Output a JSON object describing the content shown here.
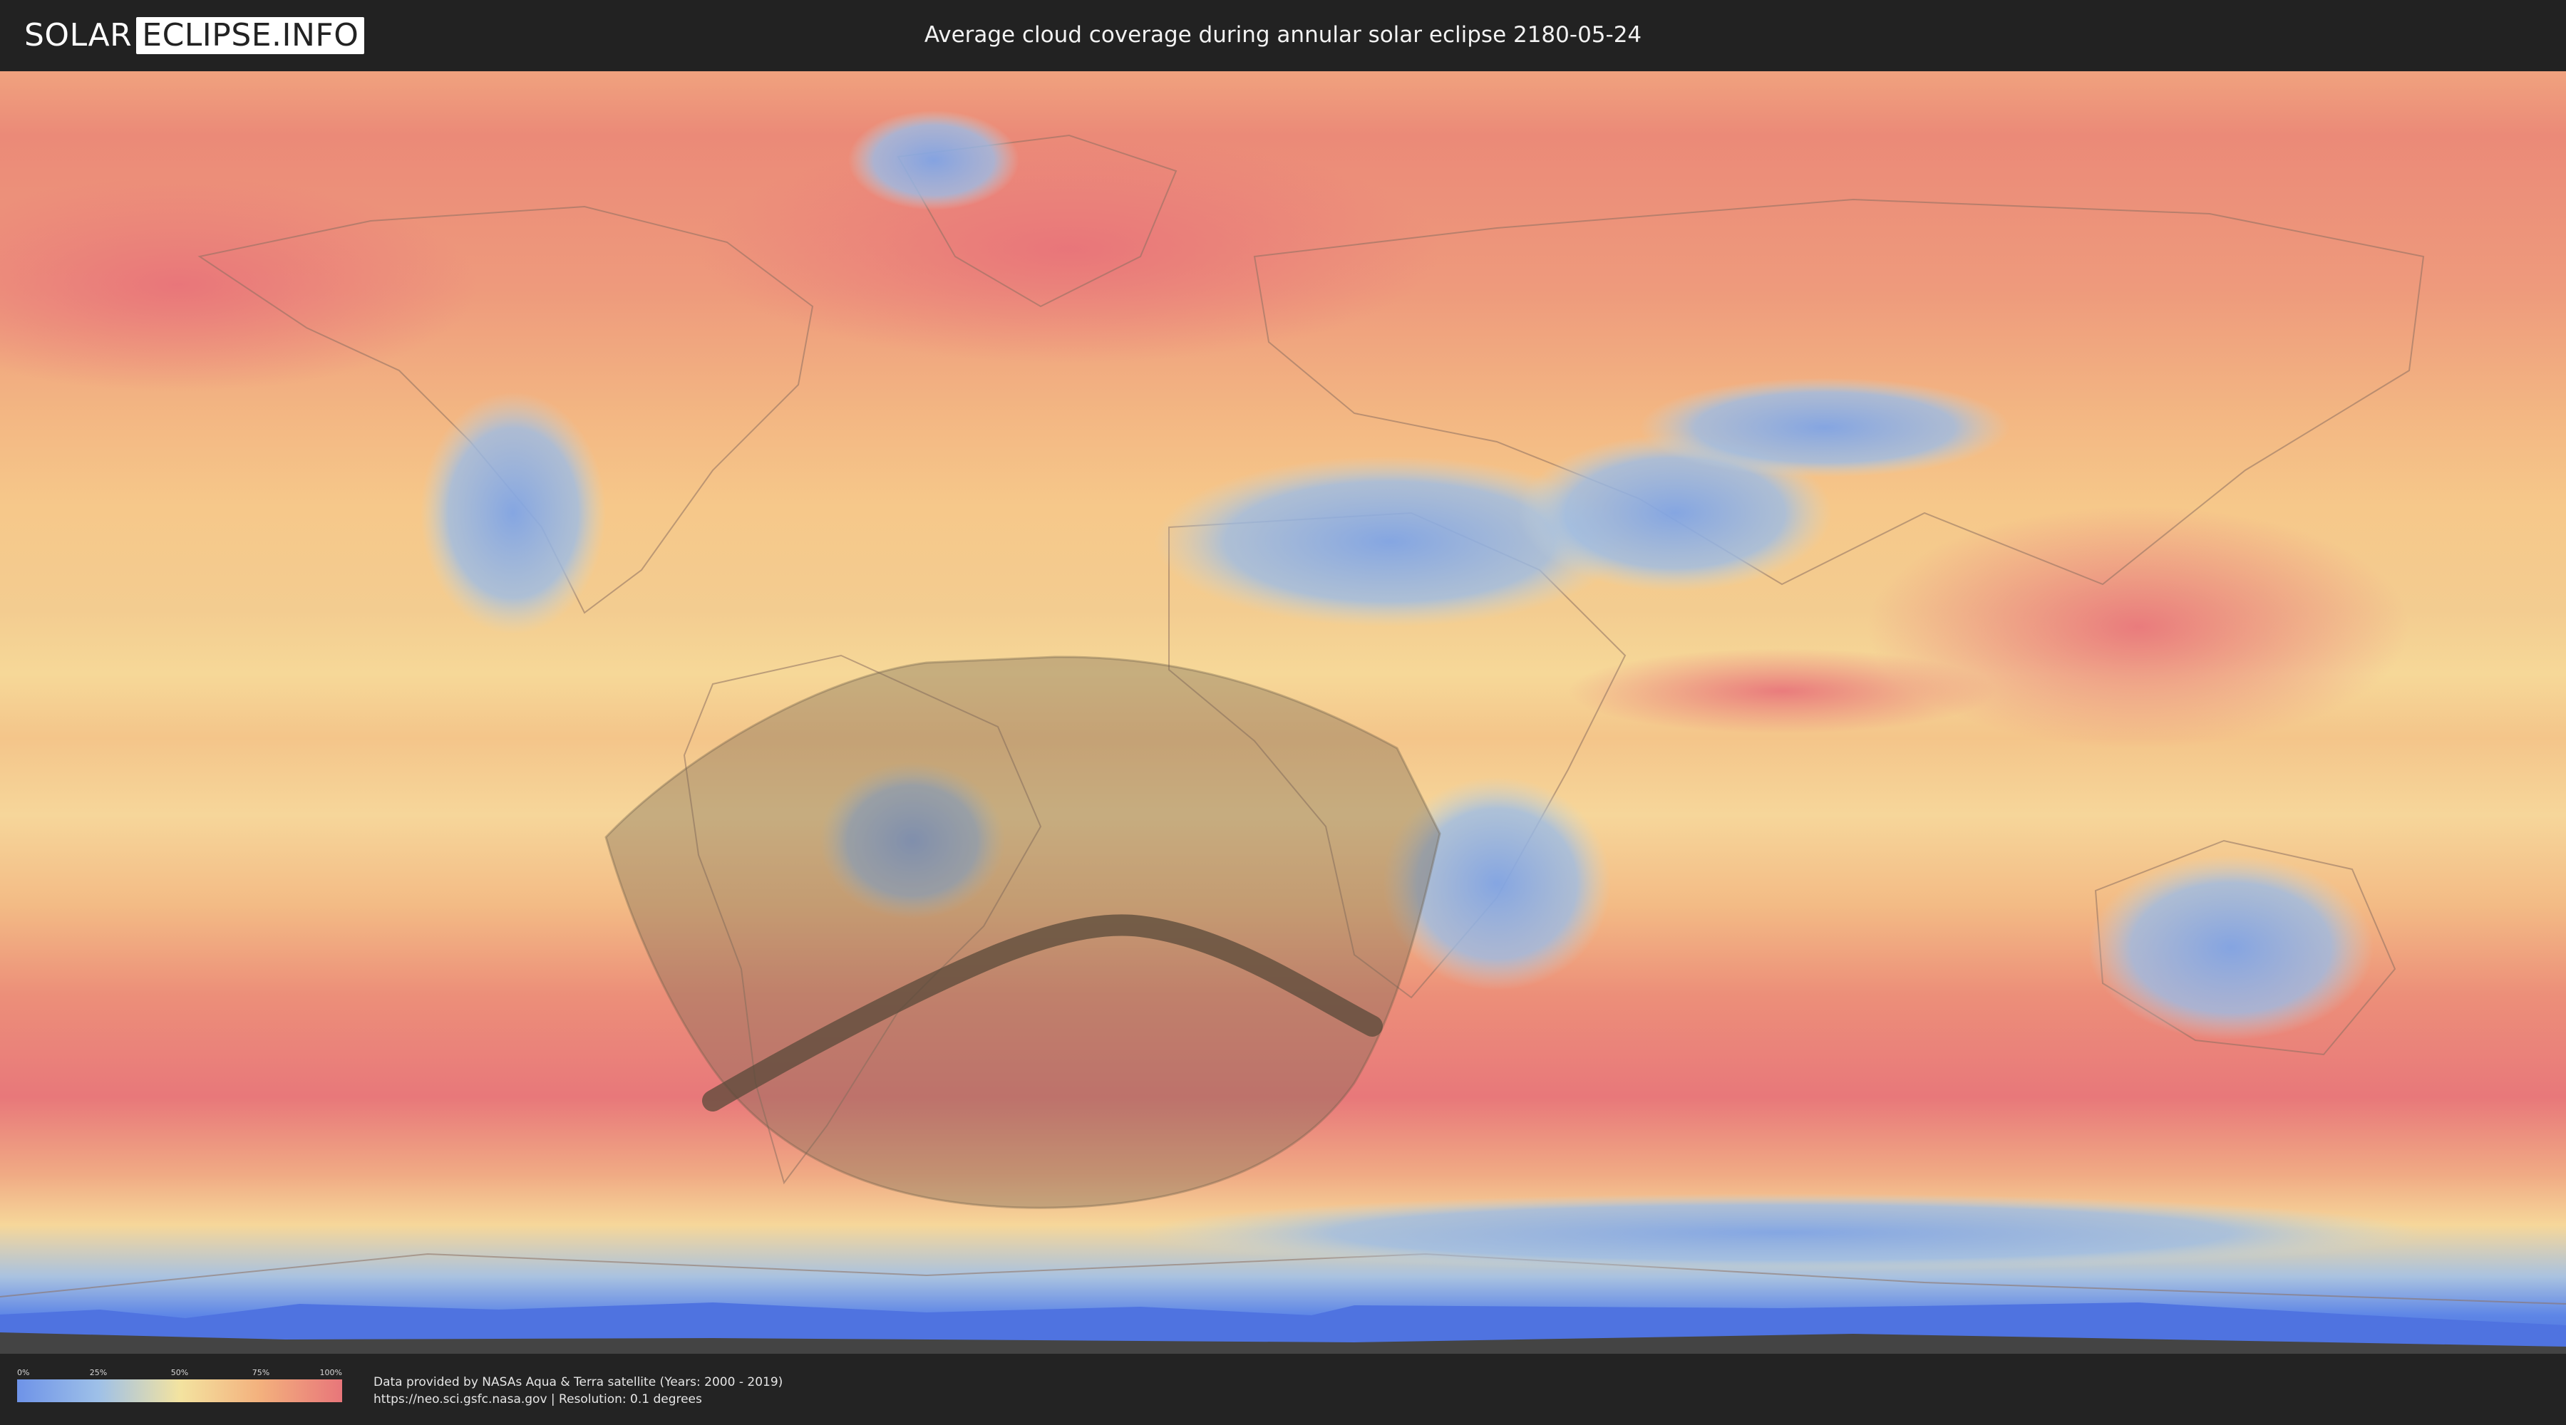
{
  "header": {
    "logo_left": "SOLAR",
    "logo_right": "ECLIPSE.INFO",
    "title": "Average cloud coverage during annular solar eclipse 2180-05-24"
  },
  "legend": {
    "ticks": [
      "0%",
      "25%",
      "50%",
      "75%",
      "100%"
    ],
    "colors": [
      "#6e93e8",
      "#9ec0e8",
      "#f3e3a0",
      "#f3b07d",
      "#e8767a"
    ]
  },
  "footer": {
    "credit_line1": "Data provided by NASAs Aqua & Terra satellite (Years: 2000 - 2019)",
    "credit_line2": "https://neo.sci.gsfc.nasa.gov | Resolution: 0.1 degrees"
  },
  "eclipse": {
    "type": "annular",
    "date": "2180-05-24"
  }
}
